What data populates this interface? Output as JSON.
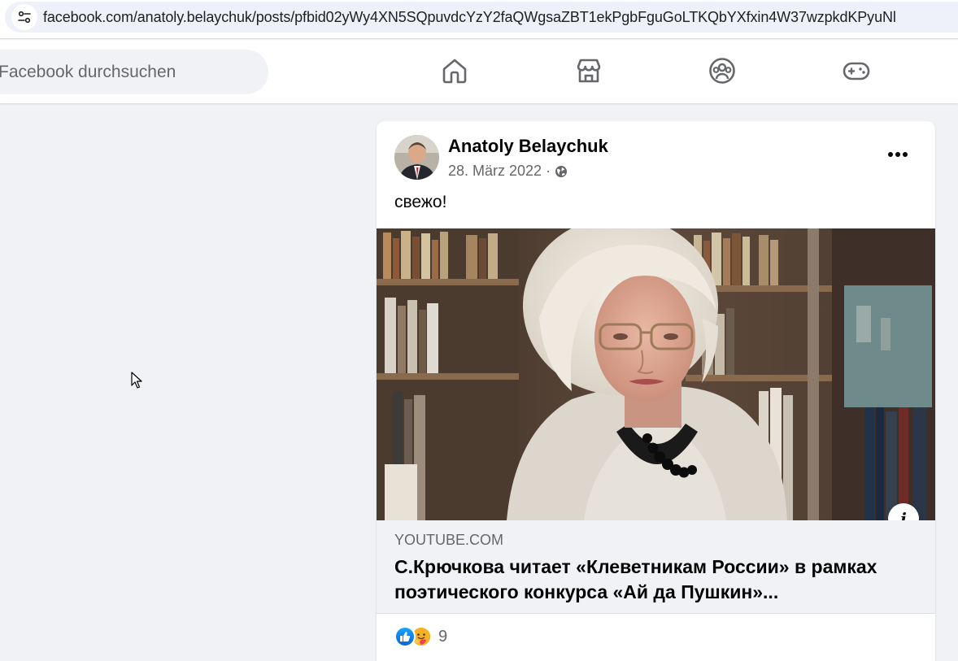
{
  "browser": {
    "url": "facebook.com/anatoly.belaychuk/posts/pfbid02yWy4XN5SQpuvdcYzY2faQWgsaZBT1ekPgbFguGoLTKQbYXfxin4W37wzpkdKPyuNl"
  },
  "topnav": {
    "search_placeholder": "Facebook durchsuchen",
    "icons": [
      "home-icon",
      "marketplace-icon",
      "groups-icon",
      "gaming-icon"
    ]
  },
  "post": {
    "author": "Anatoly Belaychuk",
    "date": "28. März 2022",
    "separator": "·",
    "privacy_icon": "globe-icon",
    "text": "свежо!",
    "link": {
      "domain": "YOUTUBE.COM",
      "title": "С.Крючкова читает «Клеветникам России» в рамках поэтического конкурса «Ай да Пушкин»..."
    },
    "reactions": {
      "types": [
        "like",
        "care"
      ],
      "count": "9"
    }
  },
  "colors": {
    "page_bg": "#f0f2f5",
    "card_bg": "#ffffff",
    "secondary_text": "#65676b",
    "primary_text": "#050505",
    "like_blue": "#0866ff"
  }
}
